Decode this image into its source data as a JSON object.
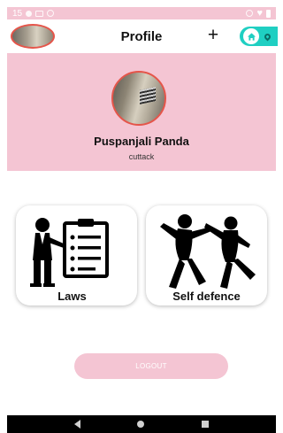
{
  "status_bar": {
    "time": "15"
  },
  "header": {
    "title": "Profile",
    "add_label": "+"
  },
  "profile": {
    "name": "Puspanjali Panda",
    "location": "cuttack"
  },
  "cards": [
    {
      "label": "Laws",
      "icon": "lawyer-checklist-icon"
    },
    {
      "label": "Self defence",
      "icon": "self-defence-icon"
    }
  ],
  "logout_label": "LOGOUT",
  "colors": {
    "accent_pink": "#f4c5d3",
    "teal": "#1fcfc2",
    "avatar_border": "#e5554a"
  }
}
